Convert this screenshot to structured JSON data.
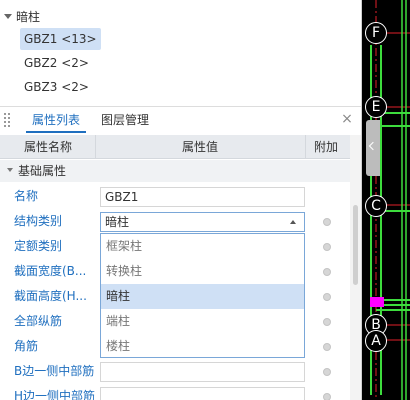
{
  "tree": {
    "root_label": "暗柱",
    "items": [
      {
        "label": "GBZ1 <13>",
        "selected": true
      },
      {
        "label": "GBZ2 <2>",
        "selected": false
      },
      {
        "label": "GBZ3 <2>",
        "selected": false
      }
    ]
  },
  "tabs": {
    "items": [
      {
        "label": "属性列表",
        "active": true
      },
      {
        "label": "图层管理",
        "active": false
      }
    ],
    "close_glyph": "×"
  },
  "table": {
    "headers": {
      "name": "属性名称",
      "value": "属性值",
      "extra": "附加"
    },
    "group_label": "基础属性",
    "rows": [
      {
        "name": "名称",
        "value": "GBZ1"
      },
      {
        "name": "结构类别",
        "value": "暗柱"
      },
      {
        "name": "定额类别",
        "value": ""
      },
      {
        "name": "截面宽度(B...",
        "value": ""
      },
      {
        "name": "截面高度(H...",
        "value": ""
      },
      {
        "name": "全部纵筋",
        "value": ""
      },
      {
        "name": "角筋",
        "value": ""
      },
      {
        "name": "B边一侧中部筋",
        "value": ""
      },
      {
        "name": "H边一侧中部筋",
        "value": ""
      }
    ]
  },
  "dropdown": {
    "options": [
      "框架柱",
      "转换柱",
      "暗柱",
      "端柱",
      "楼柱"
    ],
    "selected": "暗柱"
  },
  "canvas": {
    "axis_labels": [
      "F",
      "E",
      "C",
      "B",
      "A"
    ]
  },
  "colors": {
    "accent": "#1f6fbf",
    "selection": "#cfe0f5",
    "canvas_bg": "#000000",
    "grid_red": "#e0202a",
    "wall_green": "#3ddc3d",
    "column_magenta": "#ff00ff"
  }
}
